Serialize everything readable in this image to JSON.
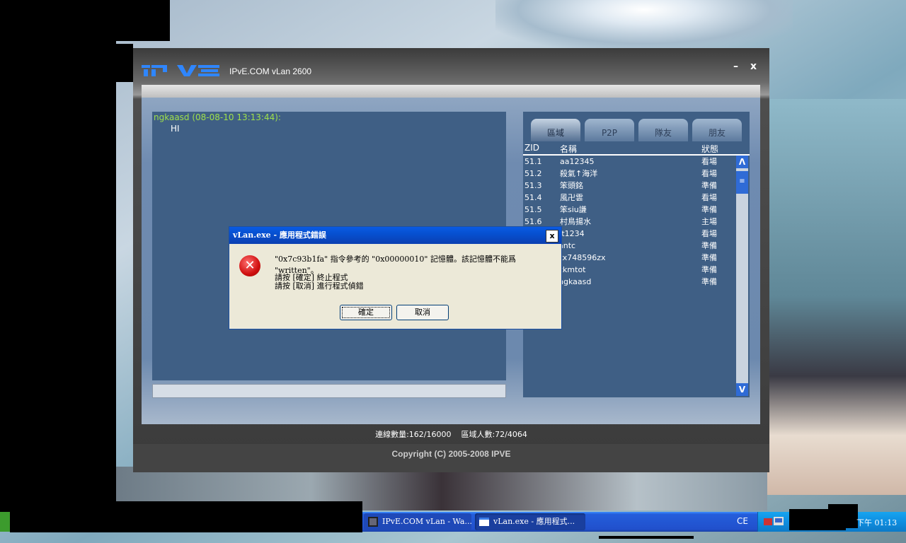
{
  "window": {
    "title": "IPvE.COM vLan 2600",
    "minimize_label": "–",
    "close_label": "x"
  },
  "chat": {
    "header": "ngkaasd (08-08-10 13:13:44):",
    "message": "HI"
  },
  "tabs": [
    "區域",
    "P2P",
    "隊友",
    "朋友"
  ],
  "list": {
    "headers": {
      "id": "ZID",
      "name": "名稱",
      "status": "狀態"
    },
    "rows": [
      {
        "id": "51.1",
        "name": "aa12345",
        "status": "看場"
      },
      {
        "id": "51.2",
        "name": "殺氣↑海洋",
        "status": "看場"
      },
      {
        "id": "51.3",
        "name": "笨頭銘",
        "status": "準備"
      },
      {
        "id": "51.4",
        "name": "風卍雲",
        "status": "看場"
      },
      {
        "id": "51.5",
        "name": "笨siu謙",
        "status": "準備"
      },
      {
        "id": "51.6",
        "name": "村鳥揚水",
        "status": "主場"
      },
      {
        "id": "",
        "name": "tt1234",
        "status": "看場"
      },
      {
        "id": "",
        "name": "antc",
        "status": "準備"
      },
      {
        "id": "",
        "name": "zx748596zx",
        "status": "準備"
      },
      {
        "id": "",
        "name": "ckmtot",
        "status": "準備"
      },
      {
        "id": "",
        "name": "ngkaasd",
        "status": "準備"
      }
    ],
    "scroll_up": "Λ",
    "scroll_down": "V",
    "scroll_thumb": "≡"
  },
  "status": {
    "text": "連線數量:162/16000    區域人數:72/4064"
  },
  "footer": {
    "copyright": "Copyright (C) 2005-2008 IPVE"
  },
  "dialog": {
    "title": "vLan.exe - 應用程式錯誤",
    "close": "x",
    "icon_glyph": "✕",
    "message": "\"0x7c93b1fa\" 指令參考的 \"0x00000010\" 記憶體。該記憶體不能爲 \"written\"。",
    "line_ok": "請按 [確定] 終止程式",
    "line_cancel": "請按 [取消] 進行程式偵錯",
    "ok_label": "確定",
    "cancel_label": "取消"
  },
  "taskbar": {
    "tasks": [
      {
        "label": "IPvE.COM vLan - Wa..."
      },
      {
        "label": "vLan.exe - 應用程式..."
      }
    ],
    "language": "CE",
    "clock": "下午 01:13"
  },
  "colors": {
    "accent": "#2f6bd6",
    "chat_header": "#9fe04a",
    "panel_bg": "#3f5f85",
    "error_red": "#d01010"
  }
}
